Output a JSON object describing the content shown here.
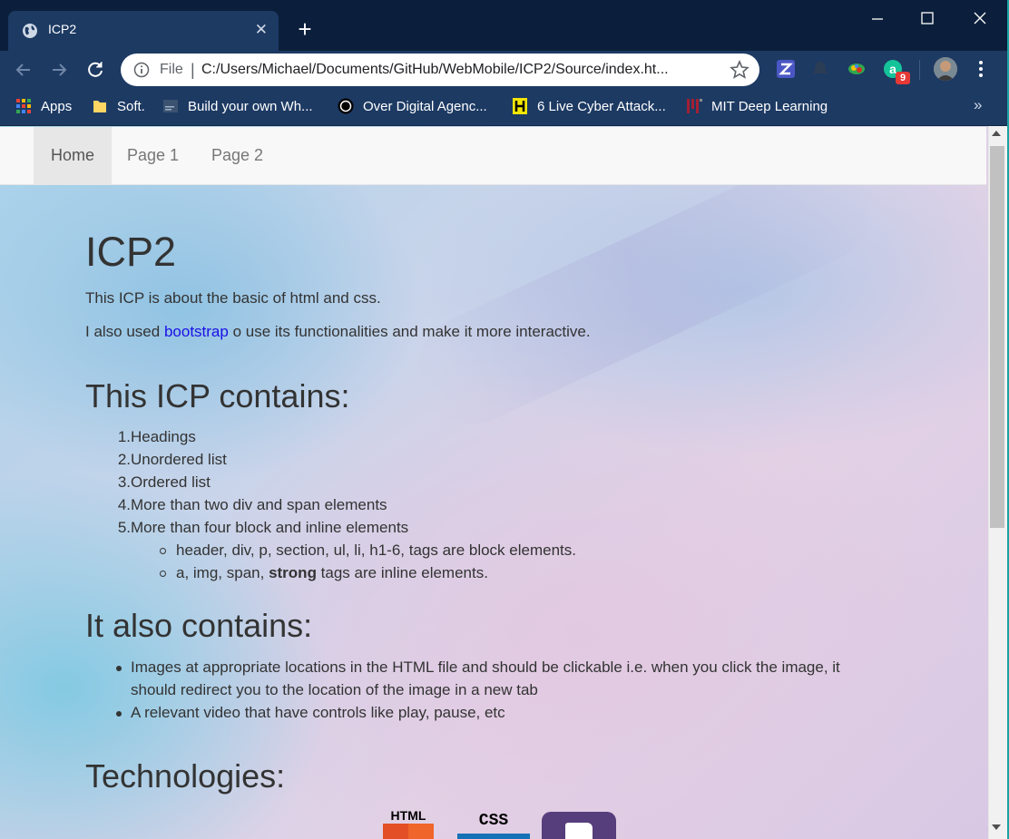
{
  "browser": {
    "tab_title": "ICP2",
    "tab_close": "✕",
    "new_tab": "+",
    "omnibox": {
      "scheme": "File",
      "separator": "|",
      "url": "C:/Users/Michael/Documents/GitHub/WebMobile/ICP2/Source/index.ht..."
    },
    "extension_badge": "9",
    "bookmarks": [
      {
        "label": "Apps",
        "icon": "apps-grid-icon"
      },
      {
        "label": "Soft.",
        "icon": "folder-icon"
      },
      {
        "label": "Build your own Wh...",
        "icon": "page-thumbnail-icon"
      },
      {
        "label": "Over Digital Agenc...",
        "icon": "circle-logo-icon"
      },
      {
        "label": "6 Live Cyber Attack...",
        "icon": "cyber-logo-icon"
      },
      {
        "label": "MIT Deep Learning",
        "icon": "mit-logo-icon"
      }
    ],
    "bookmarks_more": "»",
    "colors": {
      "frame": "#0b1f3c",
      "toolbar": "#1d3a63",
      "link": "#1a10e6"
    }
  },
  "navbar": {
    "items": [
      {
        "label": "Home",
        "active": true
      },
      {
        "label": "Page 1",
        "active": false
      },
      {
        "label": "Page 2",
        "active": false
      }
    ]
  },
  "main": {
    "title": "ICP2",
    "intro": "This ICP is about the basic of html and css.",
    "also_prefix": "I also used ",
    "also_link": "bootstrap",
    "also_suffix": " o use its functionalities and make it more interactive.",
    "contains_heading": "This ICP contains:",
    "contains_items": [
      "Headings",
      "Unordered list",
      "Ordered list",
      "More than two div and span elements",
      "More than four block and inline elements"
    ],
    "contains_numbers": [
      "1.",
      "2.",
      "3.",
      "4.",
      "5."
    ],
    "sub_items": {
      "block": "header, div, p, section, ul, li, h1-6, tags are block elements.",
      "inline_prefix": "a, img, span, ",
      "inline_strong": "strong",
      "inline_suffix": " tags are inline elements."
    },
    "also_heading": "It also contains:",
    "also_items": [
      "Images at appropriate locations in the HTML file and should be clickable i.e. when you click the image, it",
      "should redirect you to the location of the image in a new tab",
      "A relevant video that have controls like play, pause, etc"
    ],
    "tech_heading": "Technologies:",
    "tech_logos": [
      {
        "label": "HTML",
        "icon": "html5-logo-icon"
      },
      {
        "label": "CSS",
        "icon": "css3-logo-icon"
      },
      {
        "label": "B",
        "icon": "bootstrap-logo-icon"
      }
    ]
  }
}
